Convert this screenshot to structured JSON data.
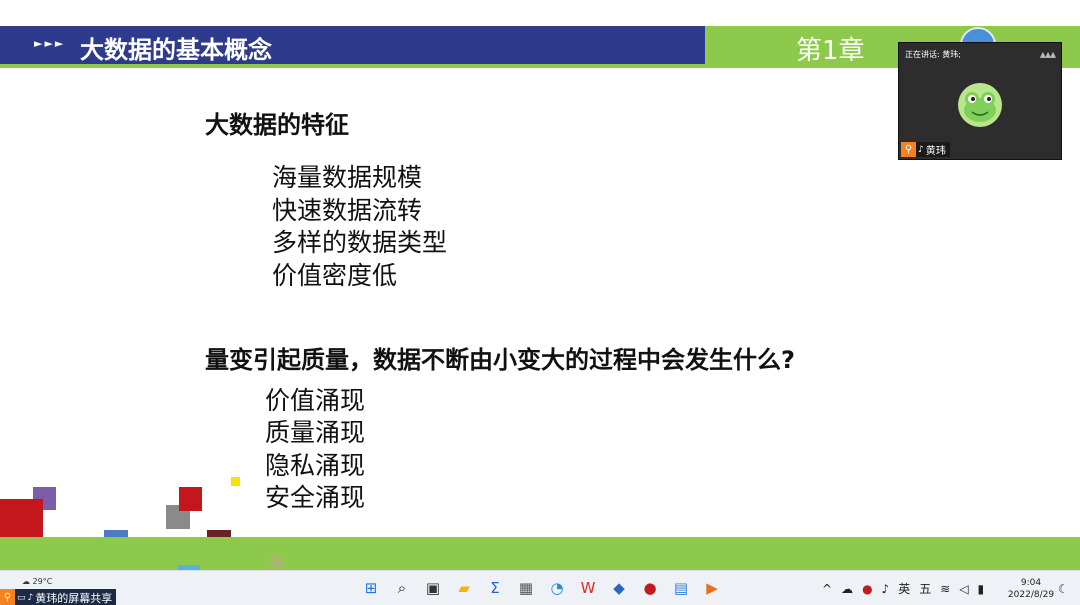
{
  "slide": {
    "header_arrows": "►►►",
    "title": "大数据的基本概念",
    "chapter": "第1章",
    "section1": {
      "title": "大数据的特征",
      "items": [
        "海量数据规模",
        "快速数据流转",
        "多样的数据类型",
        "价值密度低"
      ]
    },
    "section2": {
      "title": "量变引起质量，数据不断由小变大的过程中会发生什么?",
      "items": [
        "价值涌现",
        "质量涌现",
        "隐私涌现",
        "安全涌现"
      ]
    }
  },
  "video": {
    "speaking_label": "正在讲话: 黄玮;",
    "speaker_name": "黄玮",
    "avatar_icon": "frog-avatar-icon"
  },
  "taskbar": {
    "weather_temp": "29°C",
    "share_label": "黄玮的屏幕共享",
    "apps": [
      {
        "name": "windows-start-icon",
        "glyph": "⊞",
        "color": "#1a73e8"
      },
      {
        "name": "search-icon",
        "glyph": "⌕",
        "color": "#222222"
      },
      {
        "name": "task-view-icon",
        "glyph": "▣",
        "color": "#333333"
      },
      {
        "name": "file-explorer-icon",
        "glyph": "▰",
        "color": "#f2b519"
      },
      {
        "name": "sigma-app-icon",
        "glyph": "Σ",
        "color": "#2a66c4"
      },
      {
        "name": "calculator-icon",
        "glyph": "▦",
        "color": "#555555"
      },
      {
        "name": "edge-browser-icon",
        "glyph": "◔",
        "color": "#1f8fd6"
      },
      {
        "name": "wps-office-icon",
        "glyph": "W",
        "color": "#d93025"
      },
      {
        "name": "meeting-app-icon",
        "glyph": "◆",
        "color": "#2a66c4"
      },
      {
        "name": "media-player-icon",
        "glyph": "●",
        "color": "#c21d1d"
      },
      {
        "name": "notepad-icon",
        "glyph": "▤",
        "color": "#2f7fd8"
      },
      {
        "name": "slideshow-icon",
        "glyph": "▶",
        "color": "#e8711a"
      }
    ],
    "tray": {
      "chevron": "^",
      "ime_lang": "英",
      "ime_mode": "五"
    },
    "clock_time": "9:04",
    "clock_date": "2022/8/29"
  }
}
